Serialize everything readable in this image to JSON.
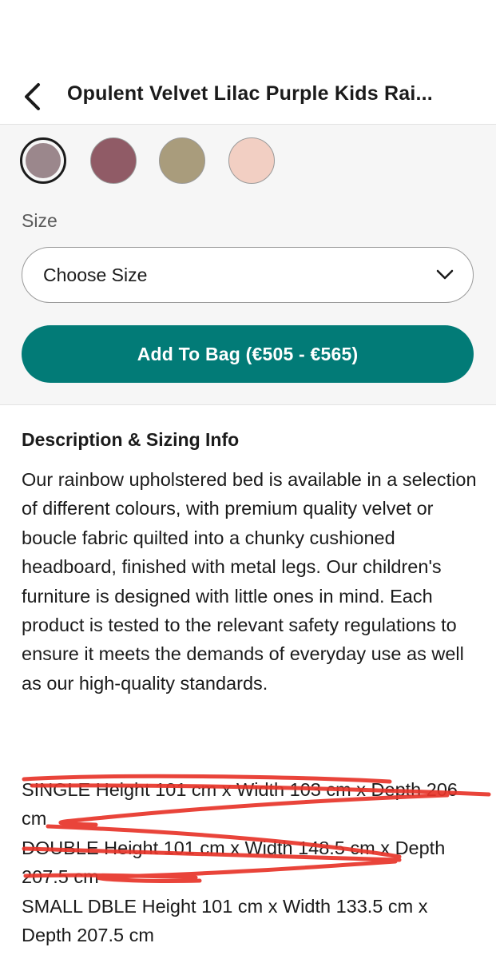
{
  "header": {
    "back_icon": "chevron-left-icon",
    "title": "Opulent Velvet Lilac Purple Kids Rai..."
  },
  "colour_swatches": [
    {
      "color": "#9b878c",
      "selected": true
    },
    {
      "color": "#905b66",
      "selected": false
    },
    {
      "color": "#a99c7c",
      "selected": false
    },
    {
      "color": "#f2cfc3",
      "selected": false
    }
  ],
  "size_selector": {
    "label": "Size",
    "placeholder": "Choose Size",
    "icon": "chevron-down-icon"
  },
  "add_to_bag": {
    "label": "Add To Bag (€505 - €565)",
    "color": "#027b77"
  },
  "description": {
    "heading": "Description & Sizing Info",
    "body": "Our rainbow upholstered bed is available in a selection of different colours, with premium quality velvet or boucle fabric quilted into a chunky cushioned headboard, finished with metal legs. Our children's furniture is designed with little ones in mind. Each product is tested to the relevant safety regulations to ensure it meets the demands of everyday use as well as our high-quality standards."
  },
  "sizes": [
    {
      "text": "SINGLE Height 101 cm x Width 103 cm x Depth 206 cm",
      "crossed_out": true
    },
    {
      "text": "DOUBLE Height 101 cm x Width 148.5 cm x Depth 207.5 cm",
      "crossed_out": true
    },
    {
      "text": "SMALL DBLE Height 101 cm x Width 133.5 cm x Depth 207.5 cm",
      "crossed_out": false
    }
  ],
  "annotation_color": "#e8352a"
}
